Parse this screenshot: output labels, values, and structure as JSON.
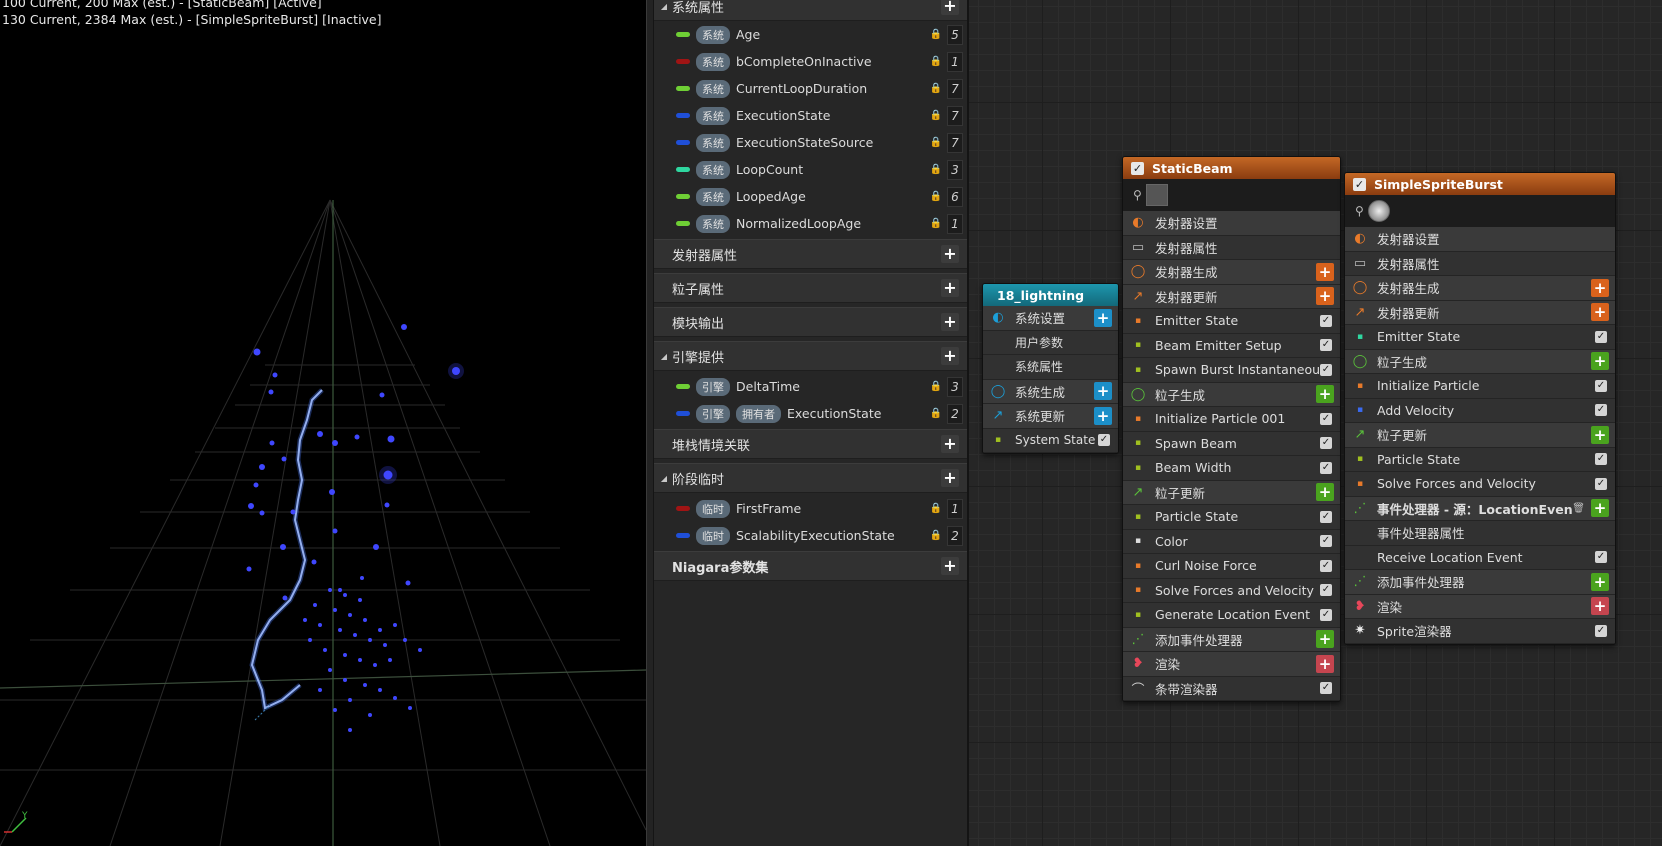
{
  "viewport": {
    "stats": [
      "100 Current, 200 Max (est.) - [StaticBeam] [Active]",
      "130 Current, 2384 Max (est.) - [SimpleSpriteBurst] [Inactive]"
    ],
    "axis_y": "Y"
  },
  "params": {
    "system_props": {
      "label": "系统属性",
      "items": [
        {
          "tag": "系统",
          "name": "Age",
          "value": "5",
          "color": "#6fcf35"
        },
        {
          "tag": "系统",
          "name": "bCompleteOnInactive",
          "value": "1",
          "color": "#a01414"
        },
        {
          "tag": "系统",
          "name": "CurrentLoopDuration",
          "value": "7",
          "color": "#6fcf35"
        },
        {
          "tag": "系统",
          "name": "ExecutionState",
          "value": "7",
          "color": "#1f4fd8"
        },
        {
          "tag": "系统",
          "name": "ExecutionStateSource",
          "value": "7",
          "color": "#1f4fd8"
        },
        {
          "tag": "系统",
          "name": "LoopCount",
          "value": "3",
          "color": "#2fd7a0"
        },
        {
          "tag": "系统",
          "name": "LoopedAge",
          "value": "6",
          "color": "#6fcf35"
        },
        {
          "tag": "系统",
          "name": "NormalizedLoopAge",
          "value": "1",
          "color": "#6fcf35"
        }
      ]
    },
    "emitter_props": "发射器属性",
    "particle_props": "粒子属性",
    "module_output": "模块输出",
    "engine": {
      "label": "引擎提供",
      "items": [
        {
          "tag": "引擎",
          "tag2": "",
          "name": "DeltaTime",
          "value": "3",
          "color": "#6fcf35"
        },
        {
          "tag": "引擎",
          "tag2": "拥有者",
          "name": "ExecutionState",
          "value": "2",
          "color": "#1f4fd8"
        }
      ]
    },
    "stack_context": "堆栈情境关联",
    "transient": {
      "label": "阶段临时",
      "items": [
        {
          "tag": "临时",
          "name": "FirstFrame",
          "value": "1",
          "color": "#a01414"
        },
        {
          "tag": "临时",
          "name": "ScalabilityExecutionState",
          "value": "2",
          "color": "#1f4fd8"
        }
      ]
    },
    "niagara_collection": "Niagara参数集"
  },
  "system_node": {
    "title": "18_lightning",
    "rows": [
      "系统设置",
      "用户参数",
      "系统属性",
      "系统生成",
      "系统更新",
      "System State"
    ]
  },
  "static_beam": {
    "title": "StaticBeam",
    "rows": [
      "发射器设置",
      "发射器属性",
      "发射器生成",
      "发射器更新",
      "Emitter State",
      "Beam Emitter Setup",
      "Spawn Burst Instantaneous",
      "粒子生成",
      "Initialize Particle 001",
      "Spawn Beam",
      "Beam Width",
      "粒子更新",
      "Particle State",
      "Color",
      "Curl Noise Force",
      "Solve Forces and Velocity",
      "Generate Location Event",
      "添加事件处理器",
      "渲染",
      "条带渲染器"
    ]
  },
  "sprite_burst": {
    "title": "SimpleSpriteBurst",
    "rows": [
      "发射器设置",
      "发射器属性",
      "发射器生成",
      "发射器更新",
      "Emitter State",
      "粒子生成",
      "Initialize Particle",
      "Add Velocity",
      "粒子更新",
      "Particle State",
      "Solve Forces and Velocity",
      "事件处理器 - 源：LocationEvent",
      "事件处理器属性",
      "Receive Location Event",
      "添加事件处理器",
      "渲染",
      "Sprite渲染器"
    ]
  },
  "colors": {
    "cyan_header": "#1a8aa0",
    "orange_header": "#b0561a",
    "orange_add": "#d9621c",
    "green_add": "#4aa31e",
    "blue_add": "#1c8fc8",
    "red_add": "#c5454f"
  }
}
